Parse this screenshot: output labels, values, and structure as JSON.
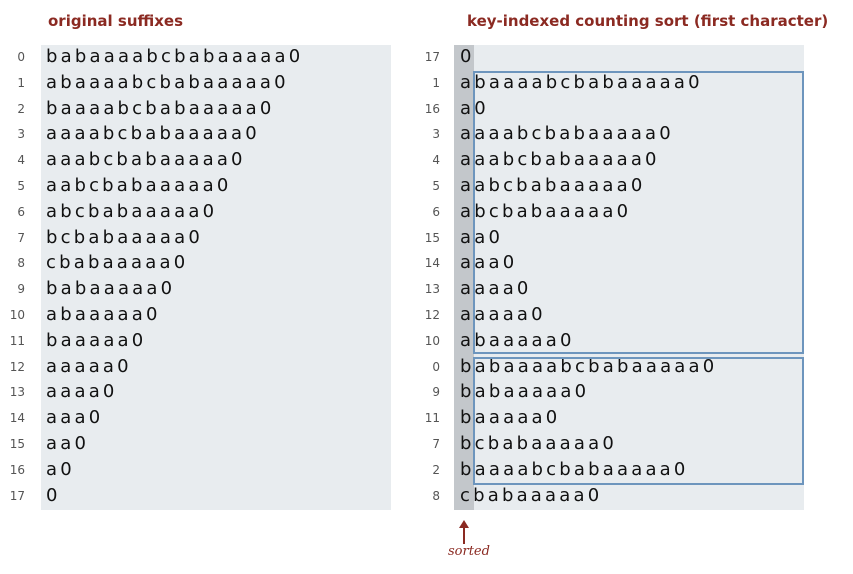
{
  "left_title": "original suffixes",
  "right_title": "key-indexed counting sort (first character)",
  "left_rows": [
    {
      "index": "0",
      "suffix": "babaaaabcbabaaaaa0"
    },
    {
      "index": "1",
      "suffix": "abaaaabcbabaaaaa0"
    },
    {
      "index": "2",
      "suffix": "baaaabcbabaaaaa0"
    },
    {
      "index": "3",
      "suffix": "aaaabcbabaaaaa0"
    },
    {
      "index": "4",
      "suffix": "aaabcbabaaaaa0"
    },
    {
      "index": "5",
      "suffix": "aabcbabaaaaa0"
    },
    {
      "index": "6",
      "suffix": "abcbabaaaaa0"
    },
    {
      "index": "7",
      "suffix": "bcbabaaaaa0"
    },
    {
      "index": "8",
      "suffix": "cbabaaaaa0"
    },
    {
      "index": "9",
      "suffix": "babaaaaa0"
    },
    {
      "index": "10",
      "suffix": "abaaaaa0"
    },
    {
      "index": "11",
      "suffix": "baaaaa0"
    },
    {
      "index": "12",
      "suffix": "aaaaa0"
    },
    {
      "index": "13",
      "suffix": "aaaa0"
    },
    {
      "index": "14",
      "suffix": "aaa0"
    },
    {
      "index": "15",
      "suffix": "aa0"
    },
    {
      "index": "16",
      "suffix": "a0"
    },
    {
      "index": "17",
      "suffix": "0"
    }
  ],
  "right_rows": [
    {
      "index": "17",
      "suffix": "0"
    },
    {
      "index": "1",
      "suffix": "abaaaabcbabaaaaa0"
    },
    {
      "index": "16",
      "suffix": "a0"
    },
    {
      "index": "3",
      "suffix": "aaaabcbabaaaaa0"
    },
    {
      "index": "4",
      "suffix": "aaabcbabaaaaa0"
    },
    {
      "index": "5",
      "suffix": "aabcbabaaaaa0"
    },
    {
      "index": "6",
      "suffix": "abcbabaaaaa0"
    },
    {
      "index": "15",
      "suffix": "aa0"
    },
    {
      "index": "14",
      "suffix": "aaa0"
    },
    {
      "index": "13",
      "suffix": "aaaa0"
    },
    {
      "index": "12",
      "suffix": "aaaaa0"
    },
    {
      "index": "10",
      "suffix": "abaaaaa0"
    },
    {
      "index": "0",
      "suffix": "babaaaabcbabaaaaa0"
    },
    {
      "index": "9",
      "suffix": "babaaaaa0"
    },
    {
      "index": "11",
      "suffix": "baaaaa0"
    },
    {
      "index": "7",
      "suffix": "bcbabaaaaa0"
    },
    {
      "index": "2",
      "suffix": "baaaabcbabaaaaa0"
    },
    {
      "index": "8",
      "suffix": "cbabaaaaa0"
    }
  ],
  "sorted_label": "sorted"
}
